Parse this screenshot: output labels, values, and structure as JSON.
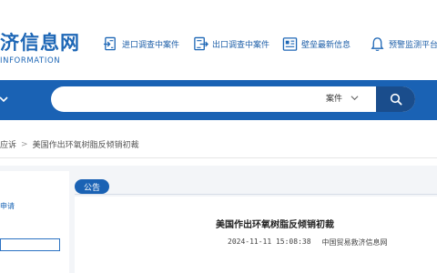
{
  "site": {
    "title_partial": "济信息网",
    "subtitle_partial": "INFORMATION"
  },
  "nav": [
    {
      "label": "进口调查中案件",
      "icon": "import-document-icon"
    },
    {
      "label": "出口调查中案件",
      "icon": "export-document-icon"
    },
    {
      "label": "壁垒最新信息",
      "icon": "barrier-news-icon"
    },
    {
      "label": "预警监测平台",
      "icon": "bell-icon"
    }
  ],
  "search": {
    "value": "",
    "scope": "案件"
  },
  "breadcrumb": {
    "parent_partial": "应诉",
    "current": "美国作出环氧树脂反倾销初裁"
  },
  "sidebar": {
    "link_partial": "申请",
    "input_value": ""
  },
  "tab": {
    "label": "公告"
  },
  "article": {
    "title": "美国作出环氧树脂反倾销初裁",
    "datetime": "2024-11-11 15:08:38",
    "source": "中国贸易救济信息网"
  },
  "colors": {
    "brand_blue": "#1a62b4",
    "dark_blue": "#1a4d8c",
    "page_bg": "#f3f5f8"
  }
}
